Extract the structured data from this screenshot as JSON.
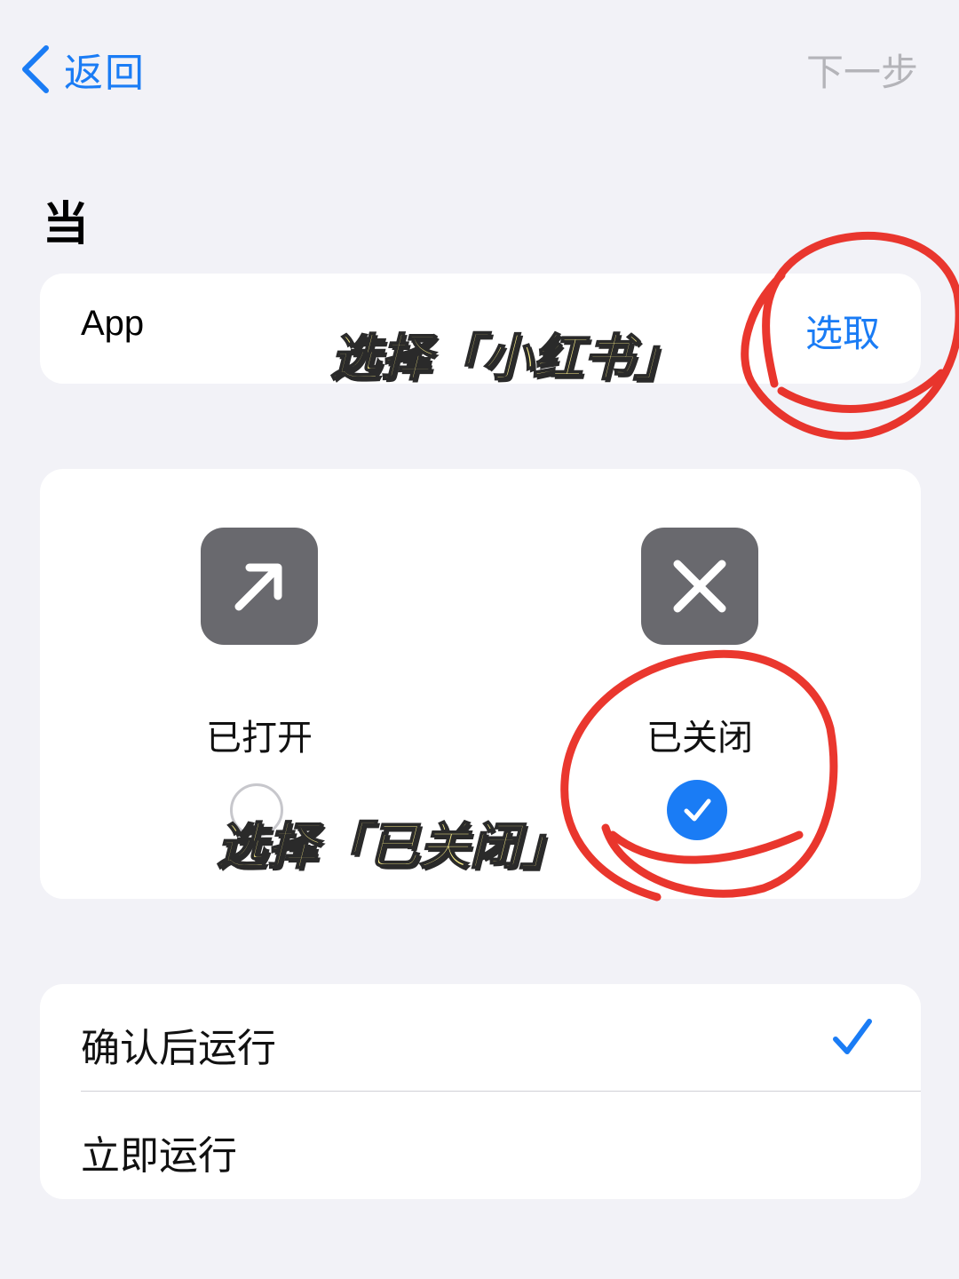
{
  "nav": {
    "back_label": "返回",
    "next_label": "下一步"
  },
  "section": {
    "title": "当"
  },
  "app_row": {
    "label": "App",
    "choose_label": "选取"
  },
  "state_options": [
    {
      "label": "已打开",
      "icon": "arrow-up-right-icon",
      "selected": false
    },
    {
      "label": "已关闭",
      "icon": "x-icon",
      "selected": true
    }
  ],
  "run_options": [
    {
      "label": "确认后运行",
      "selected": true
    },
    {
      "label": "立即运行",
      "selected": false
    }
  ],
  "annotations": {
    "app_hint": "选择「小红书」",
    "state_hint": "选择「已关闭」"
  },
  "colors": {
    "accent": "#1a7cf5",
    "background": "#f2f2f7",
    "icon_tile": "#69696e",
    "annotation_circle": "#e8261c",
    "annotation_text": "#fdf08a"
  }
}
